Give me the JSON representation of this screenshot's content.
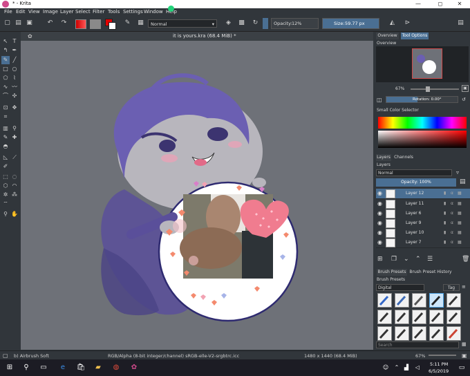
{
  "window": {
    "title": "* - Krita",
    "min_label": "—",
    "max_label": "◻",
    "close_label": "✕"
  },
  "menu": [
    "File",
    "Edit",
    "View",
    "Image",
    "Layer",
    "Select",
    "Filter",
    "Tools",
    "Settings",
    "Window",
    "Help"
  ],
  "toolbar": {
    "blend_mode": "Normal",
    "opacity_label": "Opacity:",
    "opacity_value": "12%",
    "size_label": "Size:",
    "size_value": "59.77 px"
  },
  "document": {
    "tab_title": "it is yours.kra (68.4 MiB) *"
  },
  "docker": {
    "overview_tab": "Overview",
    "tool_options_tab": "Tool Options",
    "overview_label": "Overview",
    "zoom": "67%",
    "rotation": "Rotation: 0.00°",
    "color_selector_label": "Small Color Selector",
    "layers_tab": "Layers",
    "channels_tab": "Channels",
    "layers_label": "Layers",
    "layer_blend": "Normal",
    "layer_opacity": "Opacity:  100%",
    "layers": [
      {
        "name": "Layer 12",
        "selected": true
      },
      {
        "name": "Layer 11",
        "selected": false
      },
      {
        "name": "Layer 6",
        "selected": false
      },
      {
        "name": "Layer 9",
        "selected": false
      },
      {
        "name": "Layer 10",
        "selected": false
      },
      {
        "name": "Layer 7",
        "selected": false
      }
    ],
    "brush_presets_tab": "Brush Presets",
    "brush_history_tab": "Brush Preset History",
    "brush_presets_label": "Brush Presets",
    "brush_filter": "Digital",
    "tag_label": "Tag",
    "search_placeholder": "Search"
  },
  "status": {
    "brush": "b) Airbrush Soft",
    "color_model": "RGB/Alpha (8-bit integer/channel)  sRGB-elle-V2-srgbtrc.icc",
    "dimensions": "1480 x 1440 (68.4 MiB)",
    "zoom": "67%"
  },
  "taskbar": {
    "time": "5:11 PM",
    "date": "6/5/2019"
  }
}
